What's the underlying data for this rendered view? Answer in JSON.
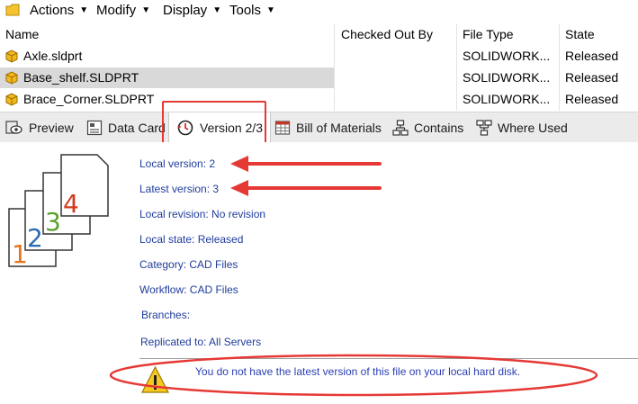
{
  "menu": {
    "actions": "Actions",
    "modify": "Modify",
    "display": "Display",
    "tools": "Tools"
  },
  "columns": {
    "name": "Name",
    "checked_out_by": "Checked Out By",
    "file_type": "File Type",
    "state": "State"
  },
  "files": [
    {
      "name": "Axle.sldprt",
      "checked_out_by": "",
      "type": "SOLIDWORK...",
      "state": "Released",
      "selected": false
    },
    {
      "name": "Base_shelf.SLDPRT",
      "checked_out_by": "",
      "type": "SOLIDWORK...",
      "state": "Released",
      "selected": true
    },
    {
      "name": "Brace_Corner.SLDPRT",
      "checked_out_by": "",
      "type": "SOLIDWORK...",
      "state": "Released",
      "selected": false
    }
  ],
  "tabs": [
    {
      "label": "Preview",
      "icon": "eye-icon"
    },
    {
      "label": "Data Card",
      "icon": "data-card-icon"
    },
    {
      "label": "Version 2/3",
      "icon": "version-history-icon",
      "active": true
    },
    {
      "label": "Bill of Materials",
      "icon": "table-icon"
    },
    {
      "label": "Contains",
      "icon": "hierarchy-icon"
    },
    {
      "label": "Where Used",
      "icon": "where-used-icon"
    }
  ],
  "info": {
    "local_version": "Local version: 2",
    "latest_version": "Latest version: 3",
    "local_revision": "Local revision: No revision",
    "local_state": "Local state: Released",
    "category": "Category: CAD Files",
    "workflow": "Workflow: CAD Files",
    "branches": "Branches:",
    "replicated_to": "Replicated to: All Servers"
  },
  "illustration": {
    "digits": [
      "1",
      "2",
      "3",
      "4"
    ],
    "digit_colors": [
      "#e8731a",
      "#2a6bb0",
      "#5aa02c",
      "#d43a1f"
    ]
  },
  "warning": {
    "text": "You do not have the latest version of this file on your local hard disk.",
    "icon": "warning-triangle-icon"
  },
  "annotation_color": "#e53935"
}
